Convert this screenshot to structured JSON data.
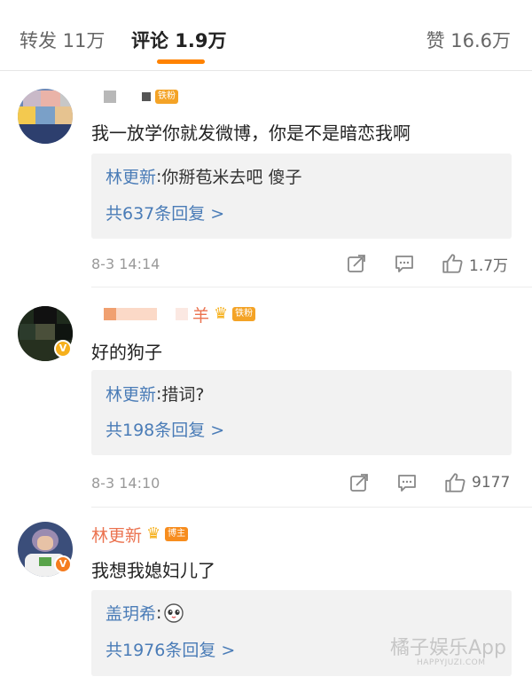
{
  "tabs": {
    "repost": "转发 11万",
    "comments": "评论 1.9万",
    "likes": "赞 16.6万"
  },
  "comments": [
    {
      "name": "",
      "badge": "铁粉",
      "text": "我一放学你就发微博，你是不是暗恋我啊",
      "reply_author": "林更新",
      "reply_sep": ": ",
      "reply_text": "你掰苞米去吧 傻子",
      "reply_count": "共637条回复 >",
      "time": "8-3 14:14",
      "like_count": "1.7万"
    },
    {
      "name": "",
      "name_tail": "羊",
      "badge": "铁粉",
      "verified": "V",
      "text": "好的狗子",
      "reply_author": "林更新",
      "reply_sep": ": ",
      "reply_text": "措词?",
      "reply_count": "共198条回复 >",
      "time": "8-3 14:10",
      "like_count": "9177"
    },
    {
      "name": "林更新",
      "badge": "博主",
      "verified": "V",
      "text": "我想我媳妇儿了",
      "reply_author": "盖玥希",
      "reply_sep": ": ",
      "reply_text": "",
      "reply_count": "共1976条回复 >",
      "time": "",
      "like_count": ""
    }
  ],
  "watermark": {
    "main": "橘子娱乐App",
    "sub": "HAPPYJUZI.COM"
  },
  "colors": {
    "accent": "#ff8200",
    "username": "#eb7350",
    "link": "#4a7cb7",
    "badge": "#f4a326",
    "verified_yellow": "#f6b01c",
    "verified_orange": "#f57c1f"
  },
  "icons": [
    "share-icon",
    "comment-icon",
    "like-icon",
    "crown-icon",
    "verified-icon",
    "emoji-face-icon"
  ]
}
